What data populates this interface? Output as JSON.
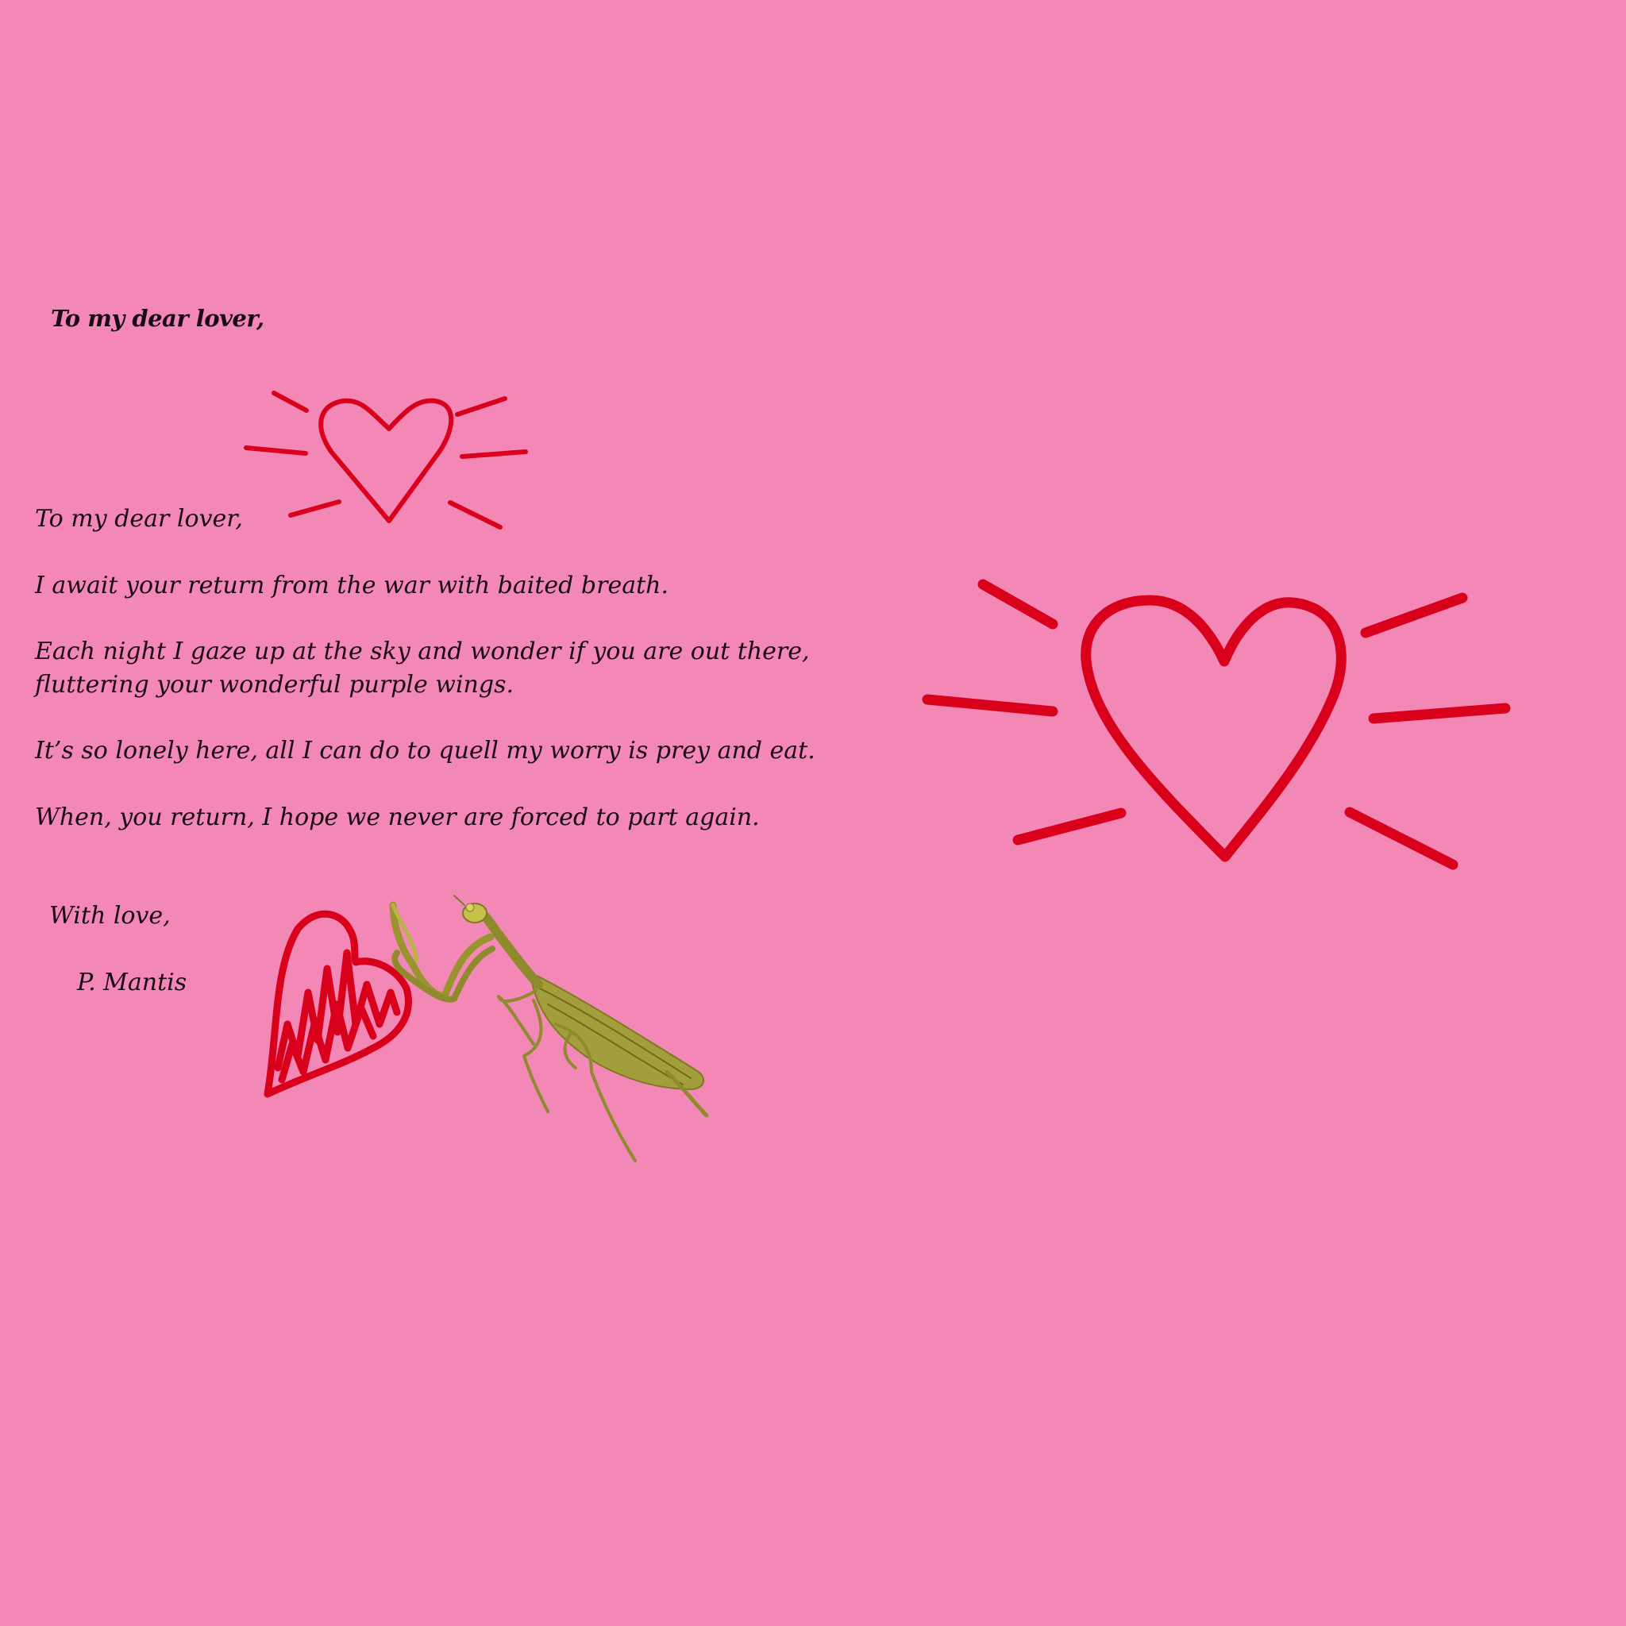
{
  "letter": {
    "title": "To my dear lover,",
    "salutation": "To my dear lover,",
    "paragraph_1": "I await your return from the war with baited breath.",
    "paragraph_2_line_1": "Each night I gaze up at the sky and wonder if you are out there,",
    "paragraph_2_line_2": "fluttering your wonderful purple wings.",
    "paragraph_3": "It’s so lonely here, all I can do to quell my worry is prey and eat.",
    "paragraph_4": "When, you return, I hope we never are forced to part again.",
    "closing": "With love,",
    "signature": "P. Mantis"
  },
  "decorations": {
    "small_heart": "radiating-heart-icon",
    "large_heart": "radiating-heart-icon",
    "scribbled_heart": "scribbled-heart-icon",
    "insect": "praying-mantis-illustration"
  },
  "colors": {
    "background": "#f388b7",
    "heart_red": "#d9001b",
    "text": "#1a0a12",
    "mantis_green": "#8f8a2c"
  }
}
